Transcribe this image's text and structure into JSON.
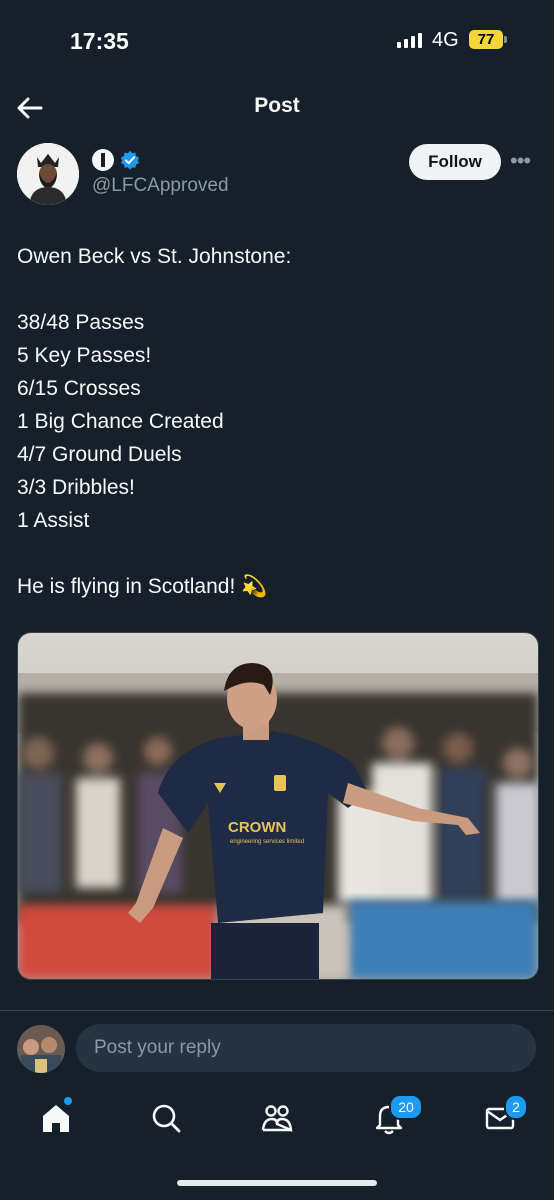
{
  "status_bar": {
    "time": "17:35",
    "network": "4G",
    "battery": "77"
  },
  "header": {
    "title": "Post"
  },
  "author": {
    "handle": "@LFCApproved",
    "follow_label": "Follow",
    "more_label": "•••"
  },
  "tweet": {
    "intro": "Owen Beck vs St. Johnstone:",
    "stats": [
      "38/48 Passes",
      "5 Key Passes!",
      "6/15 Crosses",
      "1 Big Chance Created",
      "4/7 Ground Duels",
      "3/3 Dribbles!",
      "1 Assist"
    ],
    "closing": "He is flying in Scotland! 💫",
    "media": {
      "sponsor_text": "CROWN",
      "sponsor_sub": "engineering services limited"
    }
  },
  "reply": {
    "placeholder": "Post your reply"
  },
  "nav": {
    "notifications_badge": "20",
    "messages_badge": "2"
  },
  "colors": {
    "accent": "#1d9bf0",
    "background": "#15202b",
    "muted": "#8b98a5"
  }
}
